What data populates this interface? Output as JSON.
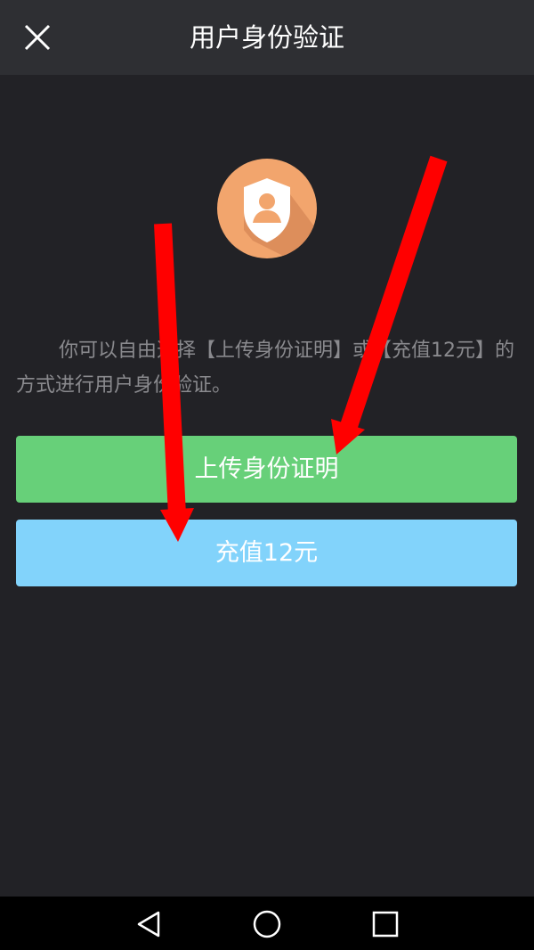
{
  "header": {
    "title": "用户身份验证",
    "close_icon": "close-icon"
  },
  "main": {
    "avatar_icon": "shield-user-icon",
    "avatar_color": "#f2a56d",
    "intro_text": "你可以自由选择【上传身份证明】或【充值12元】的方式进行用户身份验证。",
    "upload_button_label": "上传身份证明",
    "upload_button_color": "#67d079",
    "recharge_button_label": "充值12元",
    "recharge_button_color": "#82d3fb"
  },
  "annotations": {
    "arrow_color": "#ff0000",
    "arrows": [
      "arrow-to-recharge-button",
      "arrow-to-upload-button"
    ]
  },
  "navbar": {
    "back_icon": "back-triangle-icon",
    "home_icon": "home-circle-icon",
    "recents_icon": "recents-square-icon"
  }
}
